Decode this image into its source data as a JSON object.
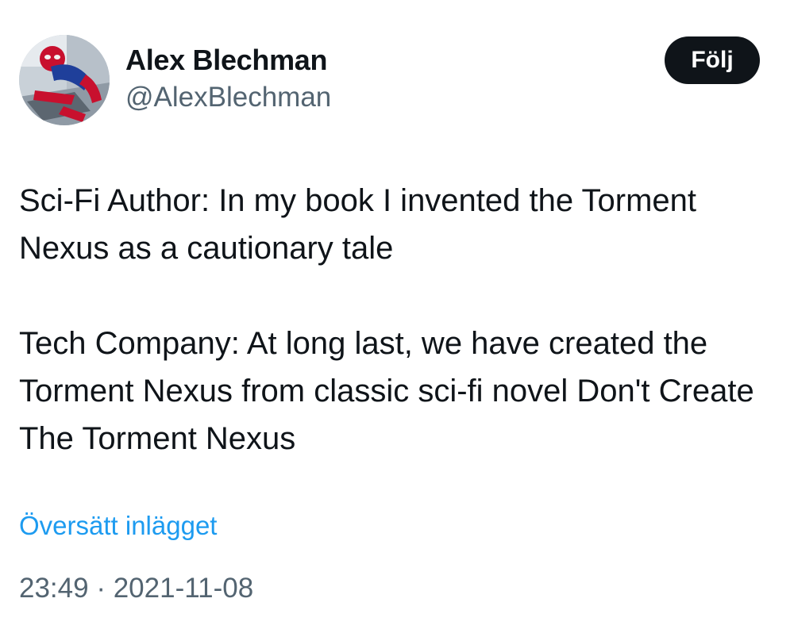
{
  "author": {
    "display_name": "Alex Blechman",
    "handle": "@AlexBlechman",
    "avatar_icon": "spider-man-avatar"
  },
  "actions": {
    "follow_label": "Följ"
  },
  "tweet": {
    "paragraphs": [
      "Sci-Fi Author: In my book I invented the Torment Nexus as a cautionary tale",
      "Tech Company: At long last, we have created the Torment Nexus from classic sci-fi novel Don't Create The Torment Nexus"
    ],
    "translate_label": "Översätt inlägget",
    "time": "23:49",
    "separator": "·",
    "date": "2021-11-08"
  },
  "colors": {
    "text": "#0f1419",
    "secondary": "#536471",
    "link": "#1d9bf0",
    "button_bg": "#0f1419"
  }
}
